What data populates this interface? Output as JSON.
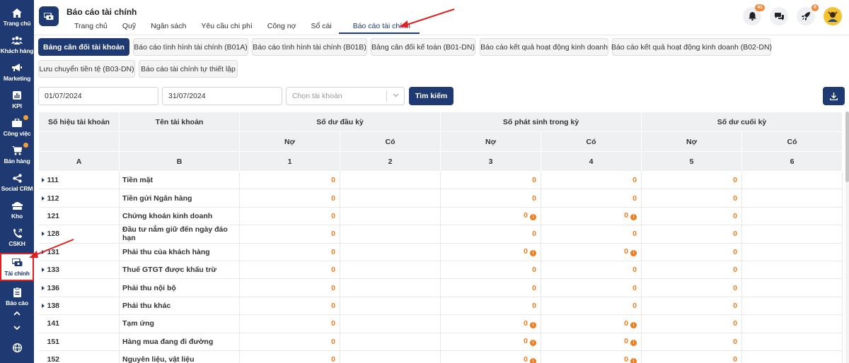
{
  "sidebar": {
    "items": [
      {
        "label": "Trang chủ",
        "icon": "home-icon",
        "dot": false
      },
      {
        "label": "Khách hàng",
        "icon": "customers-icon",
        "dot": false
      },
      {
        "label": "Marketing",
        "icon": "megaphone-icon",
        "dot": false
      },
      {
        "label": "KPI",
        "icon": "chart-icon",
        "dot": false
      },
      {
        "label": "Công việc",
        "icon": "tasks-icon",
        "dot": true
      },
      {
        "label": "Bán hàng",
        "icon": "cart-icon",
        "dot": true
      },
      {
        "label": "Social CRM",
        "icon": "share-icon",
        "dot": false
      },
      {
        "label": "Kho",
        "icon": "warehouse-icon",
        "dot": false
      },
      {
        "label": "CSKH",
        "icon": "phone-icon",
        "dot": false
      },
      {
        "label": "Tài chính",
        "icon": "finance-icon",
        "dot": false,
        "active": true
      },
      {
        "label": "Báo cáo",
        "icon": "report-icon",
        "dot": false
      }
    ]
  },
  "header": {
    "title": "Báo cáo tài chính",
    "tabs": [
      "Trang chủ",
      "Quỹ",
      "Ngân sách",
      "Yêu cầu chi phí",
      "Công nợ",
      "Sổ cái",
      "Báo cáo tài chính"
    ],
    "active_tab": "Báo cáo tài chính",
    "notifications_count": "41",
    "rocket_count": "6"
  },
  "subtabs": [
    "Bảng cân đối tài khoản",
    "Báo cáo tình hình tài chính (B01A)",
    "Báo cáo tình hình tài chính (B01B)",
    "Bảng cân đối kế toán (B01-DN)",
    "Báo cáo kết quả hoạt động kinh doanh",
    "Báo cáo kết quả hoạt động kinh doanh (B02-DN)",
    "Lưu chuyển tiền tệ (B03-DN)",
    "Báo cáo tài chính tự thiết lập"
  ],
  "filters": {
    "from_date": "01/07/2024",
    "to_date": "31/07/2024",
    "account_placeholder": "Chọn tài khoản",
    "search_label": "Tìm kiếm"
  },
  "table": {
    "headers": {
      "code": "Số hiệu tài khoản",
      "name": "Tên tài khoản",
      "opening": "Số dư đầu kỳ",
      "period": "Số phát sinh trong kỳ",
      "closing": "Số dư cuối kỳ",
      "debit": "Nợ",
      "credit": "Có",
      "col_a": "A",
      "col_b": "B",
      "col_1": "1",
      "col_2": "2",
      "col_3": "3",
      "col_4": "4",
      "col_5": "5",
      "col_6": "6"
    },
    "rows": [
      {
        "code": "111",
        "expand": true,
        "name": "Tiền mặt",
        "v1": "0",
        "v3": "0",
        "v4": "0",
        "v5": "0",
        "info": false
      },
      {
        "code": "112",
        "expand": true,
        "name": "Tiền gửi Ngân hàng",
        "v1": "0",
        "v3": "0",
        "v4": "0",
        "v5": "0",
        "info": false
      },
      {
        "code": "121",
        "expand": false,
        "name": "Chứng khoán kinh doanh",
        "v1": "0",
        "v3": "0",
        "v4": "0",
        "v5": "0",
        "info": true
      },
      {
        "code": "128",
        "expand": true,
        "name": "Đầu tư nắm giữ đến ngày đáo hạn",
        "v1": "0",
        "v3": "0",
        "v4": "0",
        "v5": "0",
        "info": false
      },
      {
        "code": "131",
        "expand": true,
        "name": "Phải thu của khách hàng",
        "v1": "0",
        "v3": "0",
        "v4": "0",
        "v5": "0",
        "info": true
      },
      {
        "code": "133",
        "expand": true,
        "name": "Thuế GTGT được khấu trừ",
        "v1": "0",
        "v3": "0",
        "v4": "0",
        "v5": "0",
        "info": false
      },
      {
        "code": "136",
        "expand": true,
        "name": "Phải thu nội bộ",
        "v1": "0",
        "v3": "0",
        "v4": "0",
        "v5": "0",
        "info": false
      },
      {
        "code": "138",
        "expand": true,
        "name": "Phải thu khác",
        "v1": "0",
        "v3": "0",
        "v4": "0",
        "v5": "0",
        "info": false
      },
      {
        "code": "141",
        "expand": false,
        "name": "Tạm ứng",
        "v1": "0",
        "v3": "0",
        "v4": "0",
        "v5": "0",
        "info": true
      },
      {
        "code": "151",
        "expand": false,
        "name": "Hàng mua đang đi đường",
        "v1": "0",
        "v3": "0",
        "v4": "0",
        "v5": "0",
        "info": true
      },
      {
        "code": "152",
        "expand": false,
        "name": "Nguyên liệu, vật liệu",
        "v1": "0",
        "v3": "0",
        "v4": "0",
        "v5": "0",
        "info": true
      }
    ]
  },
  "colors": {
    "primary": "#1f3a73",
    "accent": "#f07c1c",
    "highlight": "#e02020"
  }
}
